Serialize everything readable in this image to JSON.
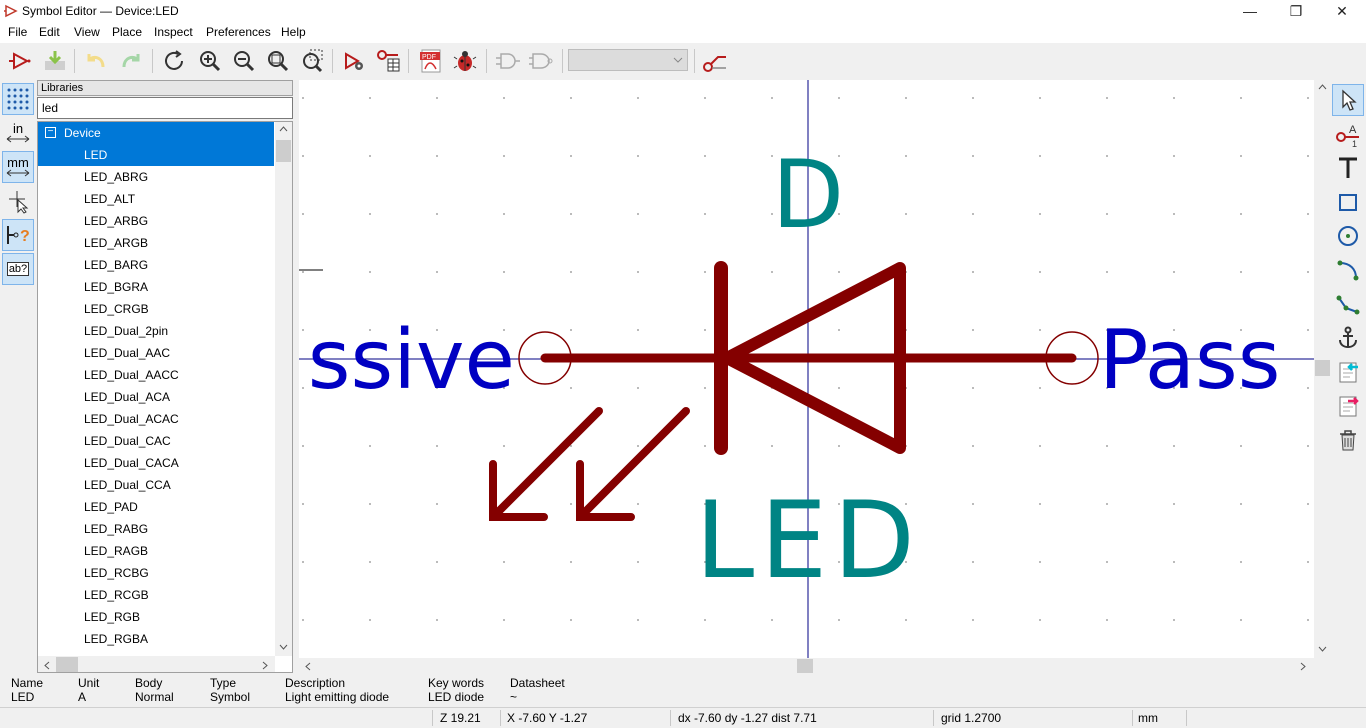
{
  "window": {
    "title": "Symbol Editor — Device:LED",
    "minimize": "—",
    "restore": "❐",
    "close": "✕"
  },
  "menu": [
    "File",
    "Edit",
    "View",
    "Place",
    "Inspect",
    "Preferences",
    "Help"
  ],
  "toolbar": {
    "items": [
      "new-symbol",
      "save",
      "undo",
      "redo",
      "refresh",
      "zoom-in",
      "zoom-out",
      "zoom-fit",
      "zoom-selection",
      "symbol-properties",
      "pin-table",
      "export-pdf",
      "inspect-bug",
      "demorgan-normal",
      "demorgan-alt",
      "unit-select",
      "show-pin-electrical"
    ],
    "unit_selector_value": ""
  },
  "left_toolbar": {
    "units_in": "in",
    "units_mm": "mm",
    "electrical_type_label": "ab?"
  },
  "libraries": {
    "header": "Libraries",
    "search_value": "led",
    "tree_expander": "−",
    "library_name": "Device",
    "items": [
      "LED",
      "LED_ABRG",
      "LED_ALT",
      "LED_ARBG",
      "LED_ARGB",
      "LED_BARG",
      "LED_BGRA",
      "LED_CRGB",
      "LED_Dual_2pin",
      "LED_Dual_AAC",
      "LED_Dual_AACC",
      "LED_Dual_ACA",
      "LED_Dual_ACAC",
      "LED_Dual_CAC",
      "LED_Dual_CACA",
      "LED_Dual_CCA",
      "LED_PAD",
      "LED_RABG",
      "LED_RAGB",
      "LED_RCBG",
      "LED_RCGB",
      "LED_RGB",
      "LED_RGBA"
    ],
    "selected": "LED"
  },
  "canvas": {
    "reference": "D",
    "value": "LED",
    "pin_left_type": "ssive",
    "pin_right_type": "Pass",
    "colors": {
      "body": "#840000",
      "field": "#008484",
      "pin_text": "#0000c2",
      "axis": "#000084"
    }
  },
  "info_panel": {
    "headers": [
      "Name",
      "Unit",
      "Body",
      "Type",
      "Description",
      "Key words",
      "Datasheet"
    ],
    "values": [
      "LED",
      "A",
      "Normal",
      "Symbol",
      "Light emitting diode",
      "LED diode",
      "~"
    ]
  },
  "statusbar": {
    "zoom": "Z 19.21",
    "cursor": "X -7.60  Y -1.27",
    "delta": "dx -7.60  dy -1.27  dist 7.71",
    "grid": "grid 1.2700",
    "units": "mm"
  }
}
